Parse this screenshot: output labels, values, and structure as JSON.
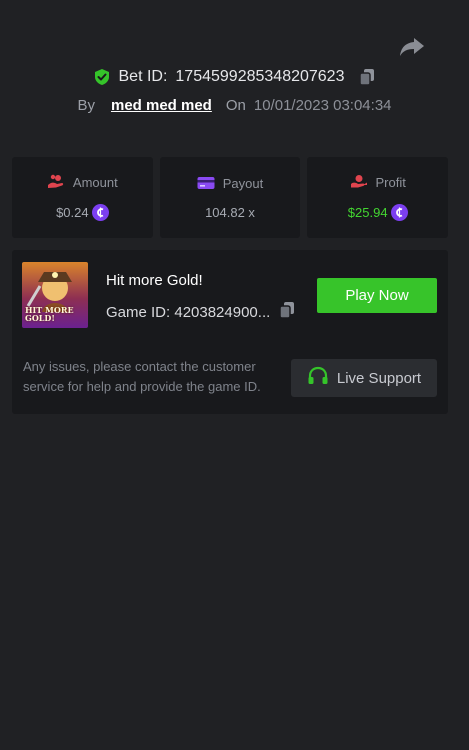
{
  "header": {
    "share_icon": "share-arrow-icon",
    "bet_label": "Bet ID:",
    "bet_id": "1754599285348207623",
    "by_label": "By",
    "username": "med med med",
    "on_label": "On",
    "datetime": "10/01/2023 03:04:34"
  },
  "stats": {
    "amount": {
      "label": "Amount",
      "value": "$0.24",
      "icon": "coins-hand-icon"
    },
    "payout": {
      "label": "Payout",
      "value": "104.82 x",
      "icon": "card-icon"
    },
    "profit": {
      "label": "Profit",
      "value": "$25.94",
      "icon": "profit-hand-icon"
    }
  },
  "game": {
    "thumb_title": "HIT MORE GOLD!",
    "name": "Hit more Gold!",
    "id_text": "Game ID: 4203824900...",
    "play_label": "Play Now",
    "issues_text": "Any issues, please contact the customer service for help and provide the game ID.",
    "support_label": "Live Support"
  },
  "colors": {
    "background": "#202124",
    "card": "#18191c",
    "accent_green": "#37c42a",
    "profit_green": "#43d531",
    "coin_purple": "#7c3ff0",
    "payout_purple": "#8a4af3",
    "icon_red": "#e0444e"
  }
}
